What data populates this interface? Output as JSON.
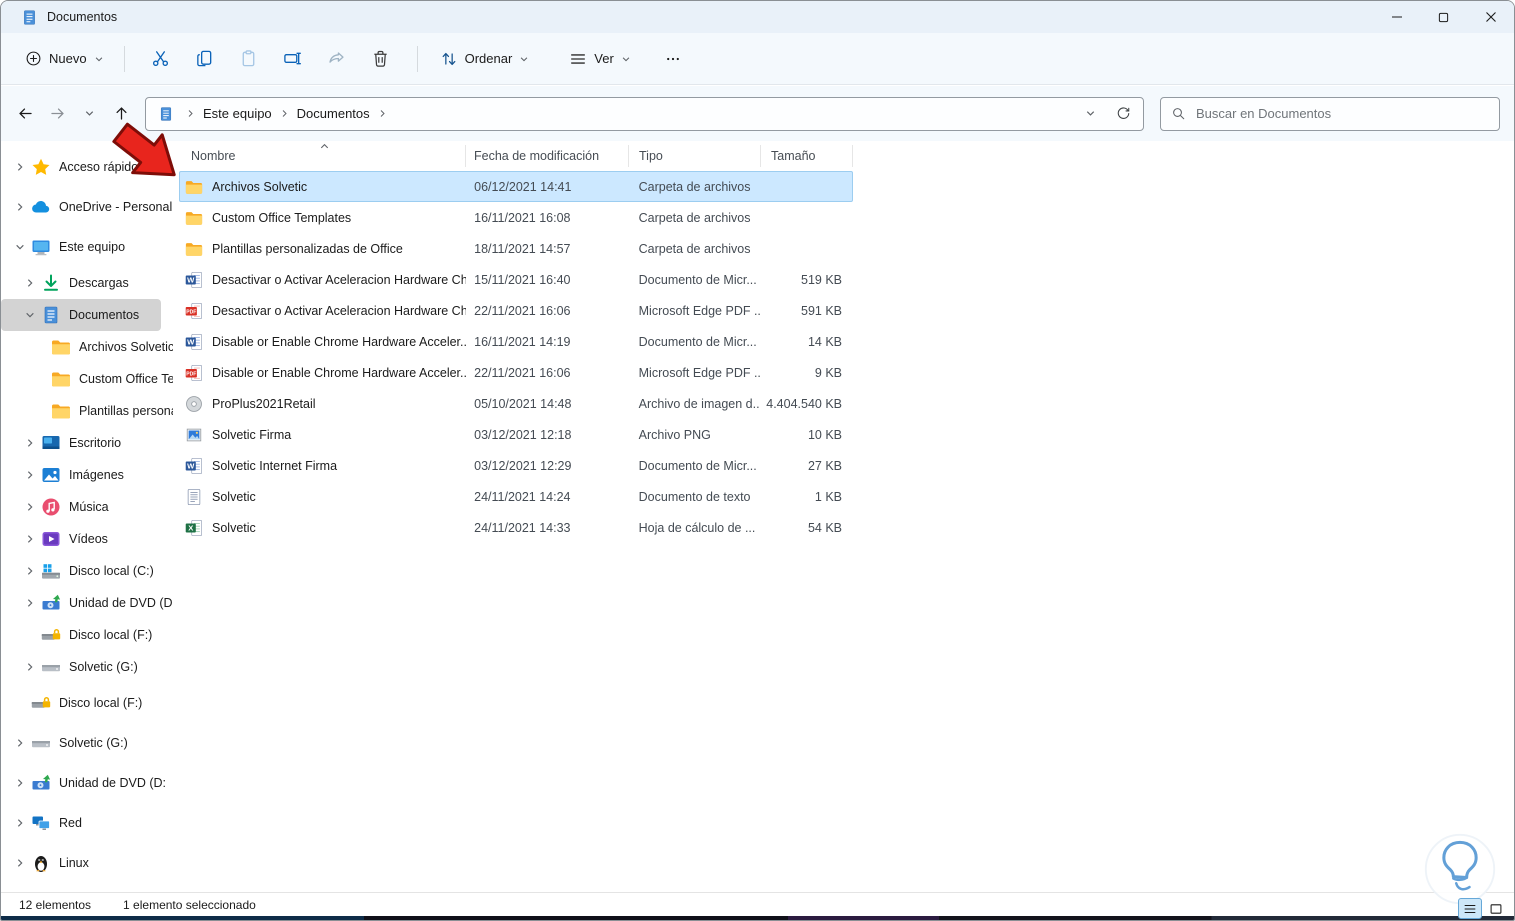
{
  "window": {
    "title": "Documentos"
  },
  "toolbar": {
    "new_label": "Nuevo",
    "sort_label": "Ordenar",
    "view_label": "Ver"
  },
  "address": {
    "crumbs": [
      "Este equipo",
      "Documentos"
    ]
  },
  "search": {
    "placeholder": "Buscar en Documentos"
  },
  "list": {
    "columns": [
      "Nombre",
      "Fecha de modificación",
      "Tipo",
      "Tamaño"
    ],
    "sorted_column": "Nombre",
    "sort_direction": "asc",
    "rows": [
      {
        "icon": "folder",
        "name": "Archivos Solvetic",
        "date": "06/12/2021 14:41",
        "type": "Carpeta de archivos",
        "size": "",
        "selected": true
      },
      {
        "icon": "folder",
        "name": "Custom Office Templates",
        "date": "16/11/2021 16:08",
        "type": "Carpeta de archivos",
        "size": ""
      },
      {
        "icon": "folder",
        "name": "Plantillas personalizadas de Office",
        "date": "18/11/2021 14:57",
        "type": "Carpeta de archivos",
        "size": ""
      },
      {
        "icon": "word",
        "name": "Desactivar o Activar Aceleracion Hardware Chr...",
        "date": "15/11/2021 16:40",
        "type": "Documento de Micr...",
        "size": "519 KB"
      },
      {
        "icon": "pdf",
        "name": "Desactivar o Activar Aceleracion Hardware Chr...",
        "date": "22/11/2021 16:06",
        "type": "Microsoft Edge PDF ...",
        "size": "591 KB"
      },
      {
        "icon": "word",
        "name": "Disable or Enable Chrome Hardware Acceler...",
        "date": "16/11/2021 14:19",
        "type": "Documento de Micr...",
        "size": "14 KB"
      },
      {
        "icon": "pdf",
        "name": "Disable or Enable Chrome Hardware Acceler...",
        "date": "22/11/2021 16:06",
        "type": "Microsoft Edge PDF ...",
        "size": "9 KB"
      },
      {
        "icon": "disc",
        "name": "ProPlus2021Retail",
        "date": "05/10/2021 14:48",
        "type": "Archivo de imagen d...",
        "size": "4.404.540 KB"
      },
      {
        "icon": "image",
        "name": "Solvetic Firma",
        "date": "03/12/2021 12:18",
        "type": "Archivo PNG",
        "size": "10 KB"
      },
      {
        "icon": "word",
        "name": "Solvetic Internet Firma",
        "date": "03/12/2021 12:29",
        "type": "Documento de Micr...",
        "size": "27 KB"
      },
      {
        "icon": "text",
        "name": "Solvetic",
        "date": "24/11/2021 14:24",
        "type": "Documento de texto",
        "size": "1 KB"
      },
      {
        "icon": "excel",
        "name": "Solvetic",
        "date": "24/11/2021 14:33",
        "type": "Hoja de cálculo de ...",
        "size": "54 KB"
      }
    ]
  },
  "sidebar": {
    "items": [
      {
        "label": "Acceso rápido",
        "icon": "star",
        "chevron": "right",
        "level": 0,
        "root": true
      },
      {
        "label": "OneDrive - Personal",
        "icon": "cloud",
        "chevron": "right",
        "level": 0,
        "root": true
      },
      {
        "label": "Este equipo",
        "icon": "pc",
        "chevron": "down",
        "level": 0,
        "root": true
      },
      {
        "label": "Descargas",
        "icon": "download",
        "chevron": "right",
        "level": 1
      },
      {
        "label": "Documentos",
        "icon": "document",
        "chevron": "down",
        "level": 1,
        "selected": true
      },
      {
        "label": "Archivos Solvetic",
        "icon": "folder",
        "chevron": "none",
        "level": 2
      },
      {
        "label": "Custom Office Templates",
        "icon": "folder",
        "chevron": "none",
        "level": 2
      },
      {
        "label": "Plantillas personalizadas de Office",
        "icon": "folder",
        "chevron": "none",
        "level": 2
      },
      {
        "label": "Escritorio",
        "icon": "desktop",
        "chevron": "right",
        "level": 1
      },
      {
        "label": "Imágenes",
        "icon": "pictures",
        "chevron": "right",
        "level": 1
      },
      {
        "label": "Música",
        "icon": "music",
        "chevron": "right",
        "level": 1
      },
      {
        "label": "Vídeos",
        "icon": "videos",
        "chevron": "right",
        "level": 1
      },
      {
        "label": "Disco local (C:)",
        "icon": "drive-windows",
        "chevron": "right",
        "level": 1
      },
      {
        "label": "Unidad de DVD (D:)",
        "icon": "dvd",
        "chevron": "right",
        "level": 1
      },
      {
        "label": "Disco local (F:)",
        "icon": "drive-lock",
        "chevron": "none",
        "level": 1
      },
      {
        "label": "Solvetic (G:)",
        "icon": "drive",
        "chevron": "right",
        "level": 1
      },
      {
        "label": "Disco local (F:)",
        "icon": "drive-lock",
        "chevron": "none",
        "level": 0,
        "root": true
      },
      {
        "label": "Solvetic (G:)",
        "icon": "drive",
        "chevron": "right",
        "level": 0,
        "root": true
      },
      {
        "label": "Unidad de DVD (D:",
        "icon": "dvd",
        "chevron": "right",
        "level": 0,
        "root": true
      },
      {
        "label": "Red",
        "icon": "network",
        "chevron": "right",
        "level": 0,
        "root": true
      },
      {
        "label": "Linux",
        "icon": "linux",
        "chevron": "right",
        "level": 0,
        "root": true
      }
    ]
  },
  "statusbar": {
    "count": "12 elementos",
    "selection": "1 elemento seleccionado"
  },
  "theme": {
    "selection_bg": "#cce8ff",
    "selection_border": "#9ccdf0",
    "accent_blue": "#0b63b8",
    "folder_yellow": "#ffd567",
    "chrome_bg": "#f4f9fd",
    "titlebar_bg": "#e9f1f9",
    "arrow_red": "#e8251d"
  }
}
